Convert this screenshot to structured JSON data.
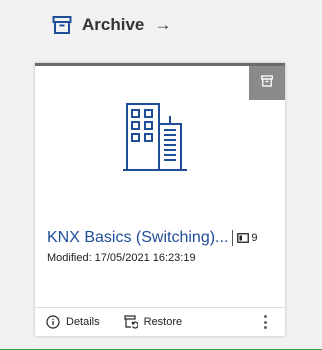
{
  "header": {
    "title": "Archive",
    "arrow": "→",
    "icon": "archive-box-icon"
  },
  "card": {
    "badge_icon": "archive-icon",
    "thumbnail_icon": "building-icon",
    "title": "KNX Basics (Switching)...",
    "count": "9",
    "count_icon": "devices-icon",
    "modified_label": "Modified:",
    "modified_value": "17/05/2021 16:23:19",
    "actions": {
      "details": "Details",
      "restore": "Restore"
    },
    "more_icon": "more-vertical-icon"
  },
  "colors": {
    "accent": "#1f4e99",
    "badge": "#8a8a8a",
    "background": "#f2f2f2",
    "bottom_line": "#3aa03a"
  }
}
